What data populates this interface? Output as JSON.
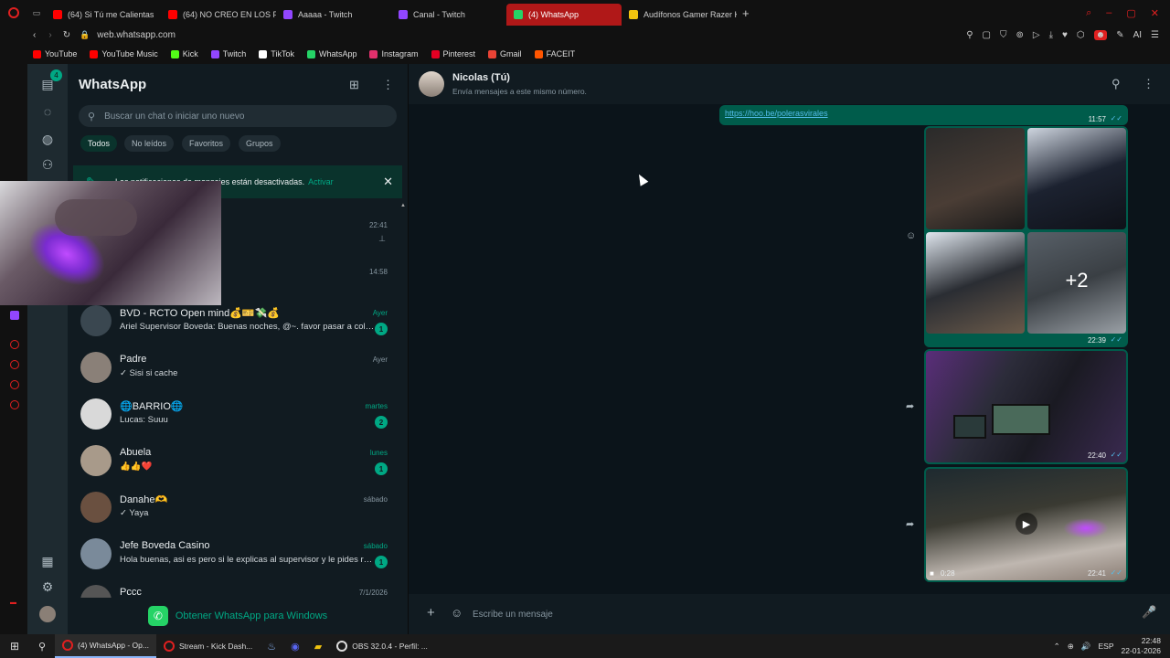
{
  "browser": {
    "tabs": [
      {
        "label": "(64) Si Tú me Calientas",
        "color": "#ff0000"
      },
      {
        "label": "(64) NO CREO EN LOS PR",
        "color": "#ff0000"
      },
      {
        "label": "Aaaaa - Twitch",
        "color": "#9146ff"
      },
      {
        "label": "Canal - Twitch",
        "color": "#9146ff"
      },
      {
        "label": "(4) WhatsApp",
        "color": "#25d366"
      },
      {
        "label": "Audífonos Gamer Razer K",
        "color": "#f1c40f"
      }
    ],
    "url": "web.whatsapp.com",
    "bookmarks": [
      {
        "label": "YouTube",
        "color": "#ff0000"
      },
      {
        "label": "YouTube Music",
        "color": "#ff0000"
      },
      {
        "label": "Kick",
        "color": "#53fc18"
      },
      {
        "label": "Twitch",
        "color": "#9146ff"
      },
      {
        "label": "TikTok",
        "color": "#ffffff"
      },
      {
        "label": "WhatsApp",
        "color": "#25d366"
      },
      {
        "label": "Instagram",
        "color": "#e1306c"
      },
      {
        "label": "Pinterest",
        "color": "#e60023"
      },
      {
        "label": "Gmail",
        "color": "#ea4335"
      },
      {
        "label": "FACEIT",
        "color": "#ff5500"
      }
    ],
    "ai_label": "AI"
  },
  "nav": {
    "chats_badge": "4"
  },
  "sidebar": {
    "title": "WhatsApp",
    "search_placeholder": "Buscar un chat o iniciar uno nuevo",
    "filters": [
      "Todos",
      "No leídos",
      "Favoritos",
      "Grupos"
    ],
    "notification": {
      "text": "Las notificaciones de mensajes están desactivadas.",
      "action": "Activar"
    },
    "hidden_rows": [
      {
        "time": "22:41"
      },
      {
        "time": "14:58"
      }
    ],
    "chats": [
      {
        "name": "BVD - RCTO Open mind💰🎫💸💰",
        "message": "Ariel Supervisor Boveda: Buenas noches, @~. favor pasar a colacion",
        "time": "Ayer",
        "unread": "1",
        "green": true
      },
      {
        "name": "Padre",
        "message": "✓ Sisi si cache",
        "time": "Ayer",
        "unread": "",
        "green": false
      },
      {
        "name": "🌐BARRIO🌐",
        "message": "Lucas: Suuu",
        "time": "martes",
        "unread": "2",
        "green": true
      },
      {
        "name": "Abuela",
        "message": "👍👍❤️",
        "time": "lunes",
        "unread": "1",
        "green": true
      },
      {
        "name": "Danahe🫶",
        "message": "✓ Yaya",
        "time": "sábado",
        "unread": "",
        "green": false
      },
      {
        "name": "Jefe Boveda Casino",
        "message": "Hola buenas, asi es pero si le explicas al supervisor y le pides rea...",
        "time": "sábado",
        "unread": "1",
        "green": true
      },
      {
        "name": "Pccc",
        "message": "",
        "time": "7/1/2026",
        "unread": "",
        "green": false
      }
    ],
    "get_windows": "Obtener WhatsApp para Windows"
  },
  "chat": {
    "name": "Nicolas (Tú)",
    "subtitle": "Envía mensajes a este mismo número.",
    "link": "https://hoo.be/polerasvirales",
    "link_time": "11:57",
    "album_more": "+2",
    "album_time": "22:39",
    "image_time": "22:40",
    "video_time": "22:41",
    "video_duration": "0:28",
    "composer_placeholder": "Escribe un mensaje"
  },
  "taskbar": {
    "items": [
      "(4) WhatsApp - Op...",
      "Stream - Kick Dash...",
      "OBS 32.0.4 - Perfil: ..."
    ],
    "lang": "ESP",
    "time": "22:48",
    "date": "22-01-2026"
  }
}
